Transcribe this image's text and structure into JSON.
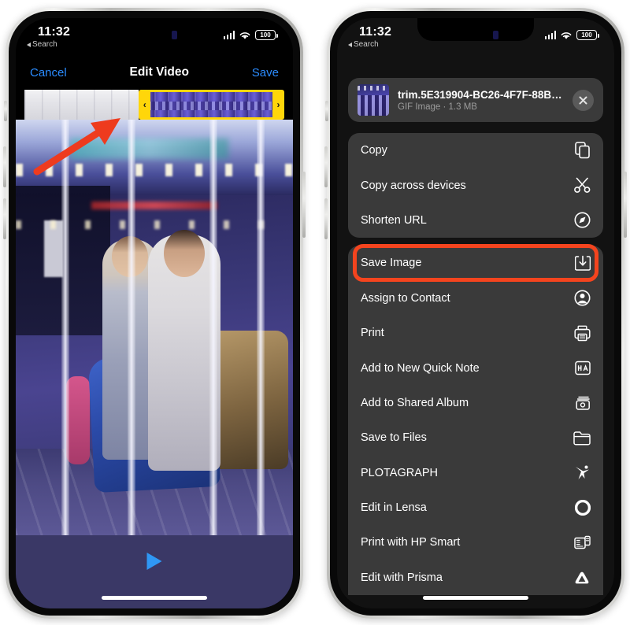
{
  "status_bar": {
    "time": "11:32",
    "back_label": "Search",
    "battery": "100",
    "signal_icon": "cellular-bars-icon",
    "wifi_icon": "wifi-icon",
    "battery_icon": "battery-icon"
  },
  "left_phone": {
    "nav": {
      "cancel_label": "Cancel",
      "title": "Edit Video",
      "save_label": "Save"
    },
    "trim": {
      "left_handle_icon": "trim-handle-left-icon",
      "right_handle_icon": "trim-handle-right-icon",
      "left_handle_glyph": "‹",
      "right_handle_glyph": "›",
      "selection_color": "#FFD60A"
    },
    "player": {
      "play_icon": "play-icon"
    },
    "annotation": {
      "arrow_color": "#ee3b1e",
      "arrow_icon": "red-arrow-icon"
    }
  },
  "right_phone": {
    "sheet_header": {
      "filename": "trim.5E319904-BC26-4F7F-88B…",
      "meta": "GIF Image · 1.3 MB",
      "close_icon": "close-icon",
      "thumbnail_icon": "file-thumbnail"
    },
    "highlight_color": "#f4441e",
    "highlighted_item": "Save Image",
    "groups": [
      {
        "items": [
          {
            "label": "Copy",
            "icon": "copy-icon"
          },
          {
            "label": "Copy across devices",
            "icon": "scissors-icon"
          },
          {
            "label": "Shorten URL",
            "icon": "compass-icon"
          }
        ]
      },
      {
        "items": [
          {
            "label": "Save Image",
            "icon": "save-download-icon"
          },
          {
            "label": "Assign to Contact",
            "icon": "contact-icon"
          },
          {
            "label": "Print",
            "icon": "printer-icon"
          },
          {
            "label": "Add to New Quick Note",
            "icon": "quick-note-icon"
          },
          {
            "label": "Add to Shared Album",
            "icon": "shared-album-icon"
          },
          {
            "label": "Save to Files",
            "icon": "folder-icon"
          },
          {
            "label": "PLOTAGRAPH",
            "icon": "plotagraph-icon"
          },
          {
            "label": "Edit in Lensa",
            "icon": "lensa-ring-icon"
          },
          {
            "label": "Print with HP Smart",
            "icon": "hp-print-icon"
          },
          {
            "label": "Edit with Prisma",
            "icon": "prisma-triangle-icon"
          }
        ]
      }
    ]
  }
}
